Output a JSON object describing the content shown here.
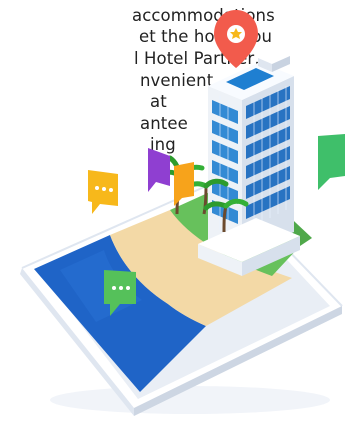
{
  "description_lines": [
    "accommodations",
    "et the hotel you",
    "l Hotel Partner,",
    "nvenient",
    "at",
    "antee",
    "ing"
  ],
  "colors": {
    "text": "#222222",
    "phone_body": "#e9eef5",
    "phone_edge": "#c9d3e1",
    "sea": "#1f64c7",
    "sand": "#f3d9a6",
    "grass": "#67c15c",
    "pin": "#f25b4c",
    "chat_yellow": "#f7b81b",
    "chat_purple": "#8f3fd1",
    "chat_green": "#55c15a",
    "building_window": "#1f7fd1"
  },
  "icons": [
    "map-pin-icon",
    "chat-bubble-icon-yellow",
    "chat-bubble-icon-purple",
    "chat-bubble-icon-orange",
    "chat-bubble-icon-green",
    "chat-bubble-icon-teal"
  ]
}
